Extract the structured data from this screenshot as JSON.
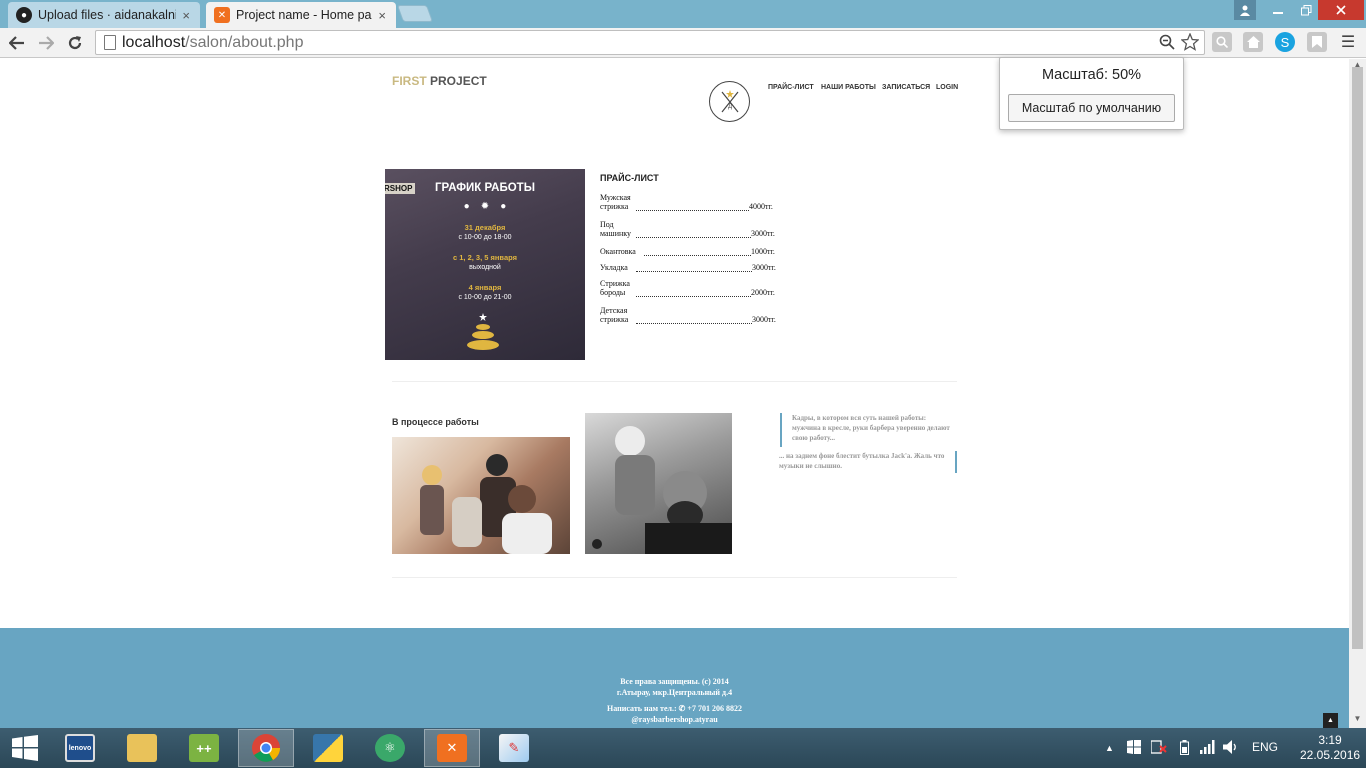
{
  "browser": {
    "tabs": [
      {
        "title": "Upload files · aidanakalniy",
        "icon": "github-icon",
        "active": false
      },
      {
        "title": "Project name - Home pag",
        "icon": "xampp-icon",
        "active": true
      }
    ],
    "close_glyph": "×",
    "url_host": "localhost",
    "url_path": "/salon/about.php",
    "zoom": {
      "label": "Масштаб: 50%",
      "reset_label": "Масштаб по умолчанию"
    }
  },
  "site": {
    "logo_first": "FIRST",
    "logo_project": "PROJECT",
    "nav": [
      "ПРАЙС-ЛИСТ",
      "НАШИ РАБОТЫ",
      "ЗАПИСАТЬСЯ",
      "LOGIN"
    ],
    "poster": {
      "shop": "RSHOP",
      "title": "ГРАФИК РАБОТЫ",
      "date1": "31 декабря",
      "time1": "с 10-00 до 18-00",
      "date2": "с 1, 2, 3, 5 января",
      "note2": "выходной",
      "date3": "4 января",
      "time3": "с 10-00 до 21-00"
    },
    "price_list": {
      "title": "ПРАЙС-ЛИСТ",
      "items": [
        {
          "name": "Мужская стрижка",
          "price": "4000тг."
        },
        {
          "name": "Под машинку",
          "price": "3000тг."
        },
        {
          "name": "Окантовка",
          "price": "1000тг."
        },
        {
          "name": "Укладка",
          "price": "3000тг."
        },
        {
          "name": "Стрижка бороды",
          "price": "2000тг."
        },
        {
          "name": "Детская стрижка",
          "price": "3000тг."
        }
      ]
    },
    "works": {
      "title": "В процессе работы",
      "quote1": "Кадры, в котором вся суть нашей работы: мужчина в кресле, руки барбера уверенно делают свою работу...",
      "quote2": "... на заднем фоне блестит бутылка Jack'a. Жаль что музыки не слышно."
    },
    "footer": {
      "line1": "Все права защищены. (с) 2014",
      "line2": "г.Атырау, мкр.Центральный д.4",
      "line3": "Написать нам тел.: ✆ +7 701 206 8822",
      "line4": "@raysbarbershop.atyrau"
    }
  },
  "taskbar": {
    "apps": [
      "windows-start",
      "lenovo",
      "file-explorer",
      "notepad-plus-plus",
      "chrome",
      "python",
      "atom",
      "xampp",
      "paint"
    ],
    "language": "ENG",
    "time": "3:19",
    "date": "22.05.2016"
  }
}
